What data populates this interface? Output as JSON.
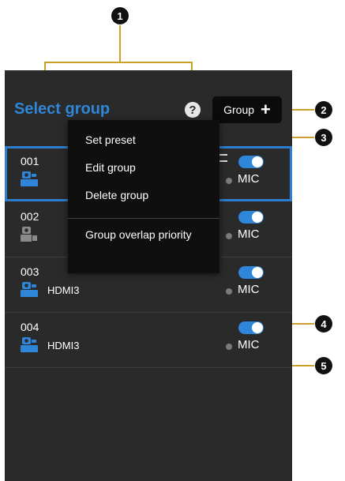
{
  "callouts": [
    "1",
    "2",
    "3",
    "4",
    "5"
  ],
  "header": {
    "title": "Select group",
    "help_glyph": "?",
    "group_button_label": "Group",
    "group_button_glyph": "+"
  },
  "groups": [
    {
      "id": "001",
      "source": "",
      "mic": "MIC",
      "enabled": true,
      "selected": true,
      "icon": "camera-hdmi-icon",
      "icon_color": "#2f86d8"
    },
    {
      "id": "002",
      "source": "",
      "mic": "MIC",
      "enabled": true,
      "selected": false,
      "icon": "camera-ip-icon",
      "icon_color": "#8a8a8a"
    },
    {
      "id": "003",
      "source": "HDMI3",
      "mic": "MIC",
      "enabled": true,
      "selected": false,
      "icon": "camera-hdmi-icon",
      "icon_color": "#2f86d8"
    },
    {
      "id": "004",
      "source": "HDMI3",
      "mic": "MIC",
      "enabled": true,
      "selected": false,
      "icon": "camera-hdmi-icon",
      "icon_color": "#2f86d8"
    }
  ],
  "context_menu": {
    "items": [
      "Set preset",
      "Edit group",
      "Delete group",
      "Group overlap priority"
    ]
  },
  "colors": {
    "accent": "#2f86d8",
    "panel": "#2a2a2a",
    "callout_line": "#c9a227"
  }
}
